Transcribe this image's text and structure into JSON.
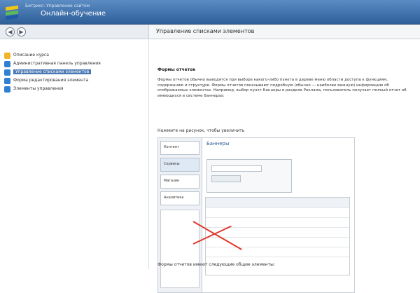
{
  "header": {
    "subtitle": "Битрикс: Управление сайтом",
    "title": "Онлайн-обучение"
  },
  "nav": {
    "back_label": "◀",
    "forward_label": "▶"
  },
  "page_title": "Управление списками элементов",
  "sidebar": {
    "items": [
      {
        "label": "Описание курса",
        "icon": "course-icon",
        "color": "#f0b429"
      },
      {
        "label": "Административная панель управления",
        "icon": "page-icon",
        "color": "#2f7fd3"
      },
      {
        "label": "Управление списками элементов",
        "icon": "page-icon",
        "color": "#2f7fd3",
        "active": true
      },
      {
        "label": "Форма редактирования элемента",
        "icon": "page-icon",
        "color": "#2f7fd3"
      },
      {
        "label": "Элементы управления",
        "icon": "page-icon",
        "color": "#2f7fd3"
      }
    ]
  },
  "content": {
    "section_title": "Формы отчетов",
    "paragraph": "Формы отчетов обычно выводятся при выборе какого-либо пункта в дереве меню области доступа к функциям, содержанию и структуре. Формы отчетов показывают подробную (обычно — наиболее важную) информацию об отображаемых элементах. Например, выбор пункт Баннеры в разделе Реклама, пользователь получает полный отчет об имеющихся в системе баннерах:",
    "click_hint": "Нажмите на рисунок, чтобы увеличить",
    "footer_text": "Формы отчетов имеют следующие общие элементы:"
  },
  "screenshot": {
    "tabs": [
      "Контент",
      "Сервисы",
      "Магазин",
      "Аналитика"
    ],
    "title": "Баннеры"
  }
}
